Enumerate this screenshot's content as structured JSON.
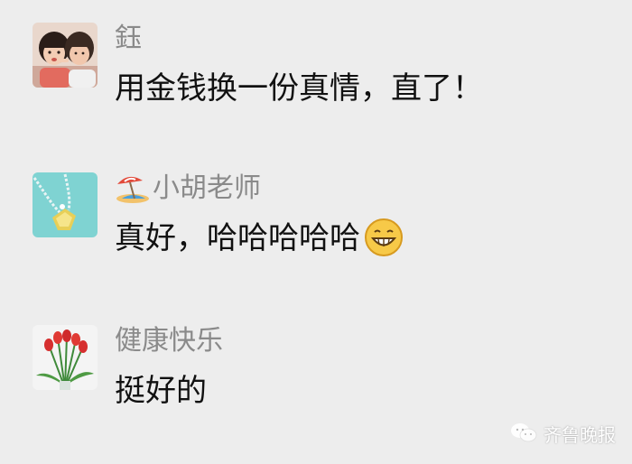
{
  "messages": [
    {
      "sender": "鈺",
      "text": "用金钱换一份真情，直了！",
      "avatar_icon": "two-girls-photo-avatar"
    },
    {
      "sender_emoji_icon": "beach-umbrella-icon",
      "sender": "小胡老师",
      "text": "真好，哈哈哈哈哈",
      "text_emoji_icon": "grinning-face-icon",
      "avatar_icon": "diamond-necklace-avatar"
    },
    {
      "sender": "健康快乐",
      "text": "挺好的",
      "avatar_icon": "red-tulips-avatar"
    }
  ],
  "watermark": {
    "text": "齐鲁晚报",
    "icon": "wechat-logo-icon"
  },
  "colors": {
    "background": "#ededed",
    "sender_name": "#8a8a8a",
    "message_text": "#111111",
    "watermark_text": "#ffffff"
  }
}
